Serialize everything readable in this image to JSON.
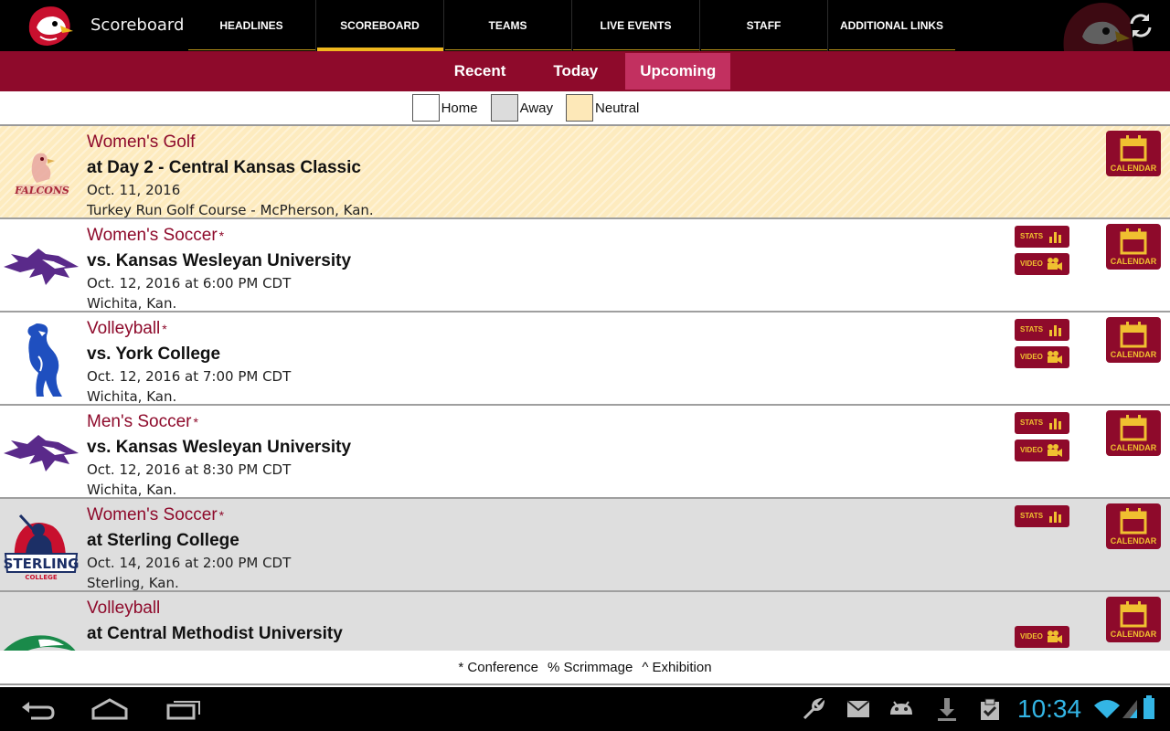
{
  "app": {
    "title": "Scoreboard"
  },
  "nav": {
    "tabs": [
      {
        "label": "HEADLINES",
        "active": false
      },
      {
        "label": "SCOREBOARD",
        "active": true
      },
      {
        "label": "TEAMS",
        "active": false
      },
      {
        "label": "LIVE EVENTS",
        "active": false
      },
      {
        "label": "STAFF",
        "active": false
      },
      {
        "label": "ADDITIONAL LINKS",
        "active": false
      }
    ]
  },
  "subtabs": [
    {
      "label": "Recent",
      "active": false
    },
    {
      "label": "Today",
      "active": false
    },
    {
      "label": "Upcoming",
      "active": true
    }
  ],
  "legend": [
    {
      "label": "Home",
      "color": "#ffffff"
    },
    {
      "label": "Away",
      "color": "#dcdcdc"
    },
    {
      "label": "Neutral",
      "color": "#fde8b8"
    }
  ],
  "buttons": {
    "stats": "STATS",
    "video": "VIDEO",
    "calendar": "CALENDAR"
  },
  "events": [
    {
      "sport": "Women's Golf",
      "conference_mark": "",
      "opponent": "at Day 2 - Central Kansas Classic",
      "when": "Oct. 11, 2016",
      "where": "Turkey Run Golf Course - McPherson, Kan.",
      "type": "neutral",
      "logo": "falcons-logo",
      "stats": false,
      "video": false
    },
    {
      "sport": "Women's Soccer",
      "conference_mark": "*",
      "opponent": "vs. Kansas Wesleyan University",
      "when": "Oct. 12, 2016 at 6:00 PM CDT",
      "where": "Wichita, Kan.",
      "type": "home",
      "logo": "coyote-logo",
      "stats": true,
      "video": true
    },
    {
      "sport": "Volleyball",
      "conference_mark": "*",
      "opponent": "vs. York College",
      "when": "Oct. 12, 2016 at 7:00 PM CDT",
      "where": "Wichita, Kan.",
      "type": "home",
      "logo": "panther-logo",
      "stats": true,
      "video": true
    },
    {
      "sport": "Men's Soccer",
      "conference_mark": "*",
      "opponent": "vs. Kansas Wesleyan University",
      "when": "Oct. 12, 2016 at 8:30 PM CDT",
      "where": "Wichita, Kan.",
      "type": "home",
      "logo": "coyote-logo",
      "stats": true,
      "video": true
    },
    {
      "sport": "Women's Soccer",
      "conference_mark": "*",
      "opponent": "at Sterling College",
      "when": "Oct. 14, 2016 at 2:00 PM CDT",
      "where": "Sterling, Kan.",
      "type": "away",
      "logo": "sterling-logo",
      "stats": true,
      "video": false
    },
    {
      "sport": "Volleyball",
      "conference_mark": "",
      "opponent": "at Central Methodist University",
      "when": "",
      "where": "",
      "type": "away",
      "logo": "eagle-logo",
      "stats": false,
      "video": true
    }
  ],
  "footer_key": [
    {
      "label": "* Conference"
    },
    {
      "label": "% Scrimmage"
    },
    {
      "label": "^ Exhibition"
    }
  ],
  "system": {
    "time": "10:34"
  },
  "colors": {
    "maroon": "#8e0a2b",
    "active_subtab": "#c23060",
    "gold": "#f0c030",
    "clock": "#33b5e5"
  }
}
